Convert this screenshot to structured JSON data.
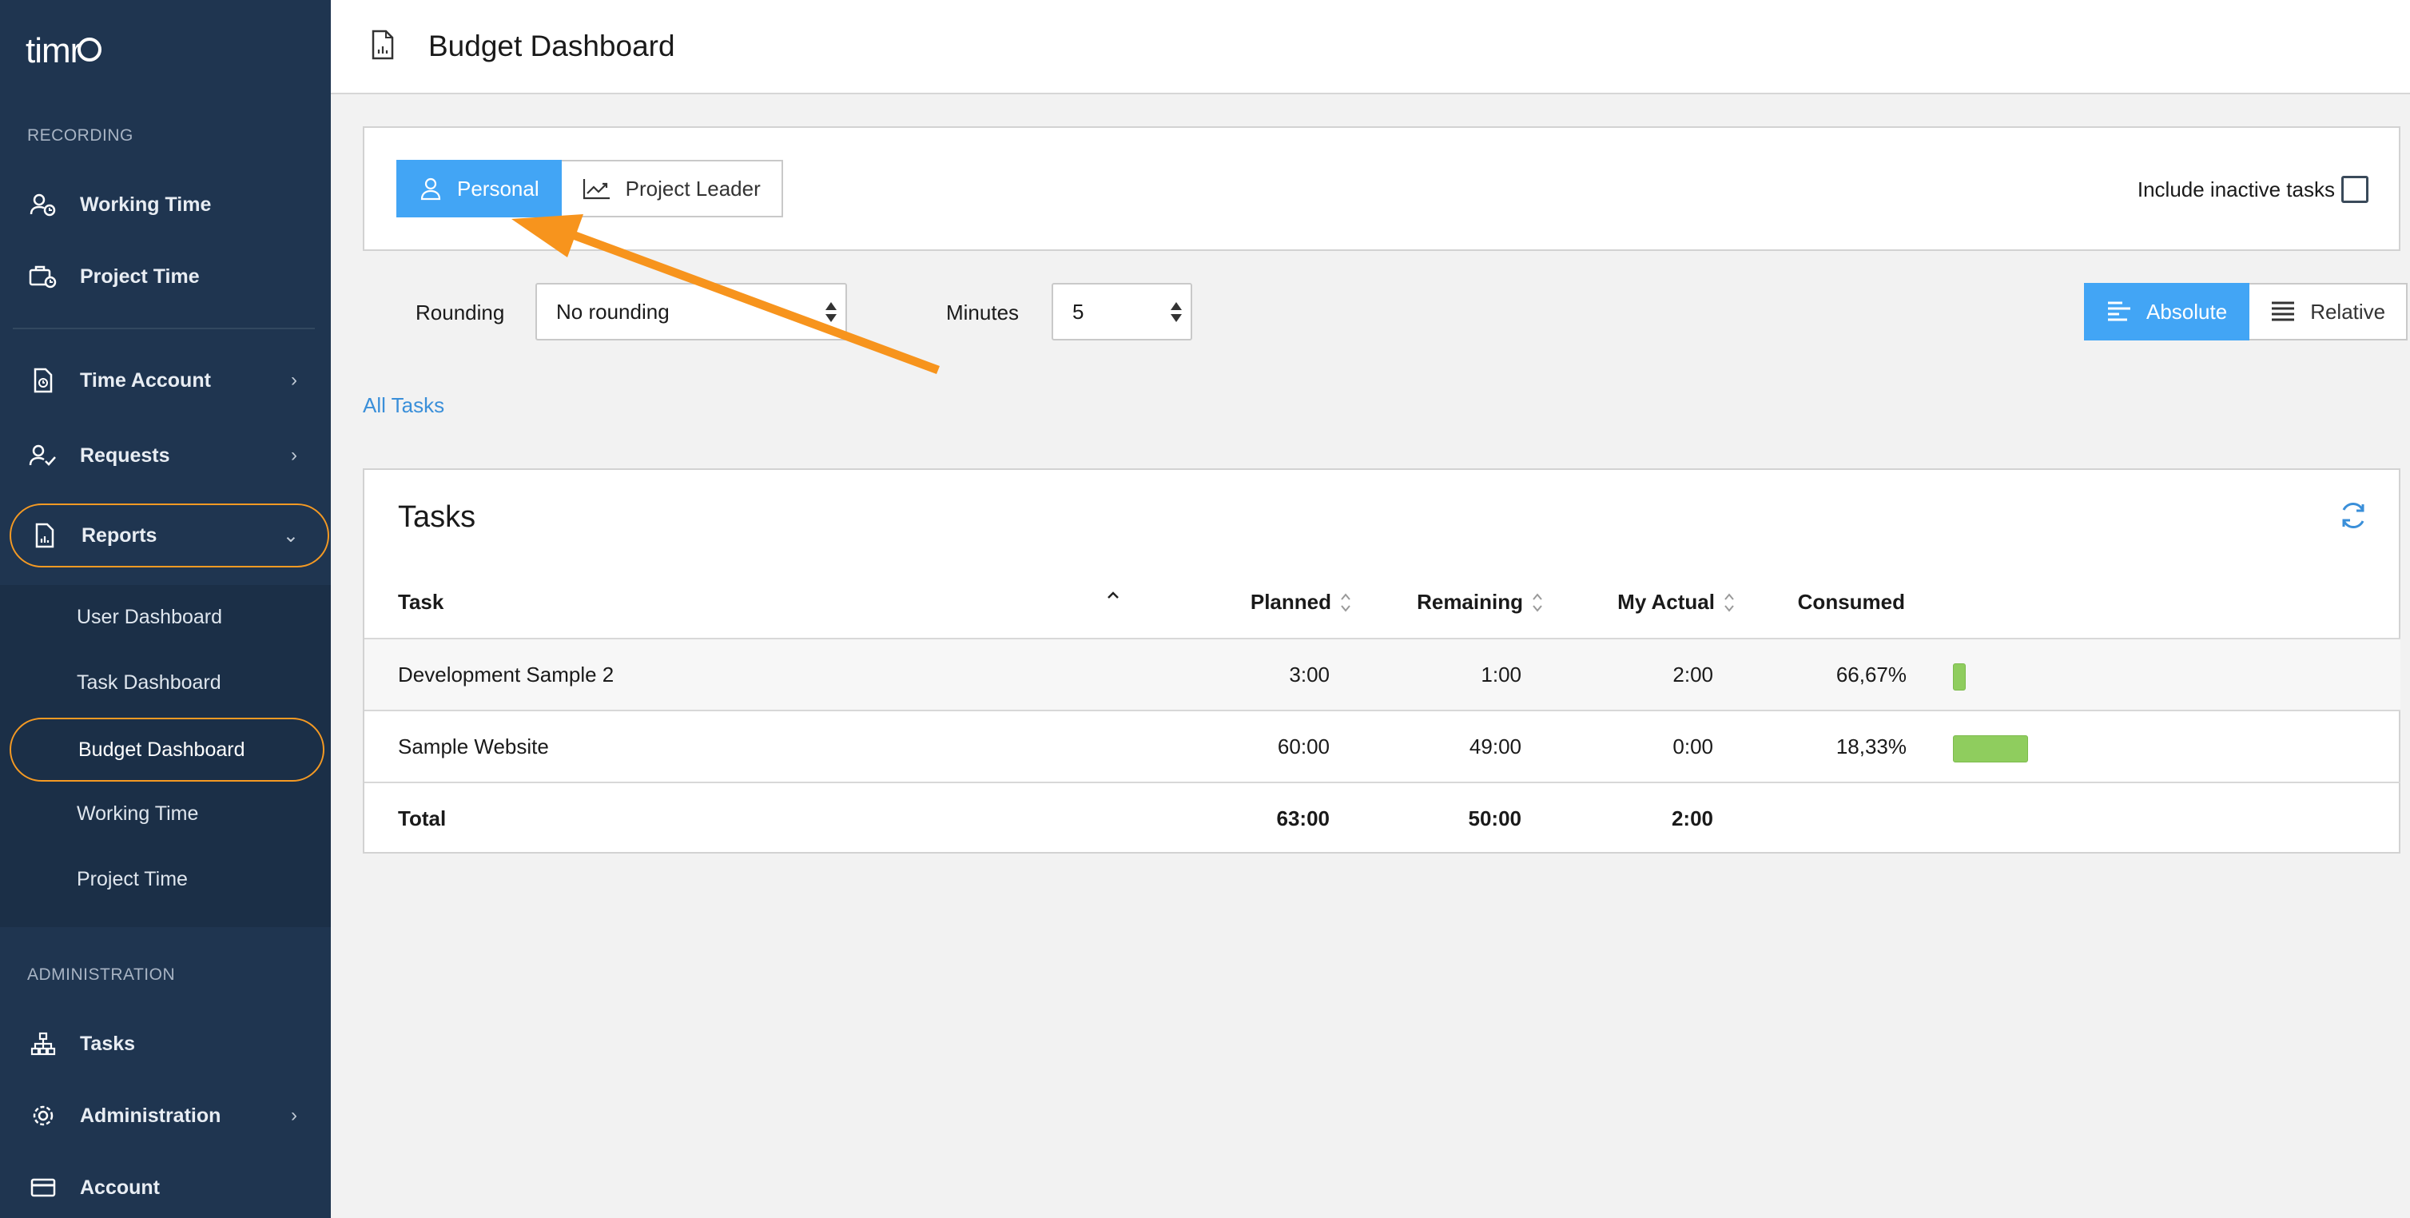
{
  "brand": {
    "logo_text": "timr"
  },
  "sidebar": {
    "recording_label": "RECORDING",
    "working_time": "Working Time",
    "project_time": "Project Time",
    "time_account": "Time Account",
    "requests": "Requests",
    "reports": "Reports",
    "reports_sub": [
      "User Dashboard",
      "Task Dashboard",
      "Budget Dashboard",
      "Working Time",
      "Project Time"
    ],
    "administration_label": "ADMINISTRATION",
    "tasks": "Tasks",
    "administration": "Administration",
    "account": "Account"
  },
  "header": {
    "title": "Budget Dashboard"
  },
  "view_toggle": {
    "personal": "Personal",
    "project_leader": "Project Leader",
    "active": "Personal"
  },
  "include_inactive": {
    "label": "Include inactive tasks",
    "checked": false
  },
  "rounding": {
    "label": "Rounding",
    "value": "No rounding"
  },
  "minutes": {
    "label": "Minutes",
    "value": "5"
  },
  "display_mode": {
    "absolute": "Absolute",
    "relative": "Relative",
    "active": "Absolute"
  },
  "breadcrumb": {
    "all_tasks": "All Tasks"
  },
  "tasks_table": {
    "title": "Tasks",
    "columns": {
      "task": "Task",
      "planned": "Planned",
      "remaining": "Remaining",
      "my_actual": "My Actual",
      "consumed": "Consumed"
    },
    "rows": [
      {
        "task": "Development Sample 2",
        "planned": "3:00",
        "remaining": "1:00",
        "my_actual": "2:00",
        "consumed": "66,67%"
      },
      {
        "task": "Sample Website",
        "planned": "60:00",
        "remaining": "49:00",
        "my_actual": "0:00",
        "consumed": "18,33%"
      }
    ],
    "total": {
      "task": "Total",
      "planned": "63:00",
      "remaining": "50:00",
      "my_actual": "2:00"
    }
  },
  "colors": {
    "accent": "#42a5f5",
    "sidebar": "#1f3550",
    "highlight": "#f59a23",
    "bar": "#8fcd5e"
  }
}
